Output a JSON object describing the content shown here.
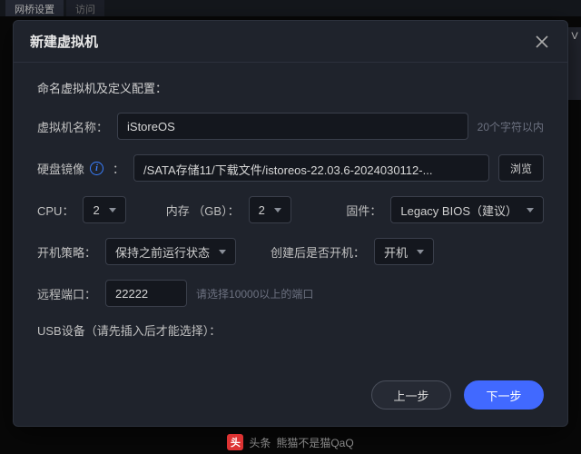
{
  "bg": {
    "tab1": "网桥设置",
    "tab2": "访问"
  },
  "modal": {
    "title": "新建虚拟机",
    "section_label": "命名虚拟机及定义配置：",
    "name_label": "虚拟机名称：",
    "name_value": "iStoreOS",
    "name_hint": "20个字符以内",
    "image_label": "硬盘镜像",
    "image_colon": "：",
    "image_path": "/SATA存储11/下载文件/istoreos-22.03.6-2024030112-...",
    "browse": "浏览",
    "cpu_label": "CPU：",
    "cpu_value": "2",
    "mem_label": "内存 （GB）：",
    "mem_value": "2",
    "fw_label": "固件：",
    "fw_value": "Legacy BIOS（建议）",
    "boot_policy_label": "开机策略：",
    "boot_policy_value": "保持之前运行状态",
    "after_create_label": "创建后是否开机：",
    "after_create_value": "开机",
    "port_label": "远程端口：",
    "port_value": "22222",
    "port_hint": "请选择10000以上的端口",
    "usb_label": "USB设备（请先插入后才能选择）：",
    "prev": "上一步",
    "next": "下一步"
  },
  "attribution": {
    "logo": "头",
    "text": "头条",
    "author": "熊猫不是猫QaQ"
  },
  "edge": "V"
}
